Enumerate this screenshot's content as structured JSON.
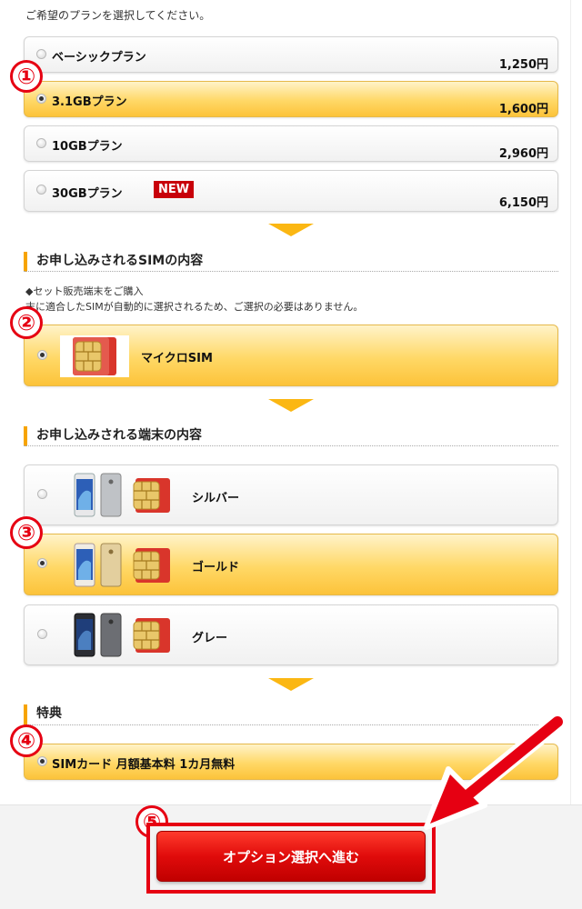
{
  "intro_text": "ご希望のプランを選択してください。",
  "plans": [
    {
      "label": "ベーシックプラン",
      "price": "1,250円",
      "selected": false
    },
    {
      "label": "3.1GBプラン",
      "price": "1,600円",
      "selected": true
    },
    {
      "label": "10GBプラン",
      "price": "2,960円",
      "selected": false
    },
    {
      "label": "30GBプラン",
      "price": "6,150円",
      "selected": false,
      "badge": "NEW"
    }
  ],
  "sim_section": {
    "title": "お申し込みされるSIMの内容",
    "note_line1": "◆セット販売端末をご購入",
    "note_line2": "末に適合したSIMが自動的に選択されるため、ご選択の必要はありません。",
    "option_label": "マイクロSIM"
  },
  "device_section": {
    "title": "お申し込みされる端末の内容",
    "options": [
      {
        "label": "シルバー",
        "selected": false
      },
      {
        "label": "ゴールド",
        "selected": true
      },
      {
        "label": "グレー",
        "selected": false
      }
    ]
  },
  "perk_section": {
    "title": "特典",
    "option_label": "SIMカード 月額基本料 1カ月無料"
  },
  "step_markers": [
    "①",
    "②",
    "③",
    "④",
    "⑤"
  ],
  "cta_label": "オプション選択へ進む",
  "colors": {
    "accent_orange": "#fbb713",
    "selected_fill": "#ffd866",
    "annotation_red": "#e60012",
    "new_badge": "#c8000a"
  }
}
